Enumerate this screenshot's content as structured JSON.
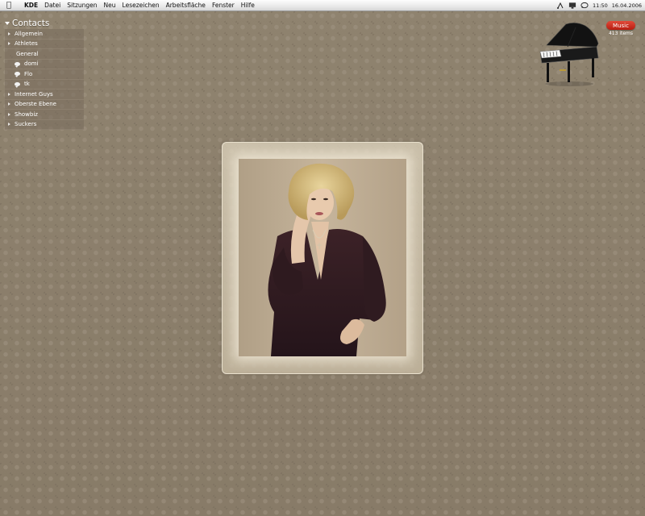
{
  "menubar": {
    "apple_icon": "apple-icon",
    "app_name": "KDE",
    "items": [
      "Datei",
      "Sitzungen",
      "Neu",
      "Lesezeichen",
      "Arbeitsfläche",
      "Fenster",
      "Hilfe"
    ],
    "time": "11:50",
    "date": "16.04.2006"
  },
  "contacts": {
    "title": "Contacts",
    "groups": [
      {
        "label": "Allgemein"
      },
      {
        "label": "Athletes"
      },
      {
        "label": "General"
      },
      {
        "label": "domi"
      },
      {
        "label": "Flo"
      },
      {
        "label": "tk"
      },
      {
        "label": "Internet Guys"
      },
      {
        "label": "Oberste Ebene"
      },
      {
        "label": "Showbiz"
      },
      {
        "label": "Suckers"
      }
    ]
  },
  "music": {
    "label": "Music",
    "count": "413 items"
  },
  "colors": {
    "desktop": "#8c7f6d",
    "music_badge": "#c8281a"
  }
}
